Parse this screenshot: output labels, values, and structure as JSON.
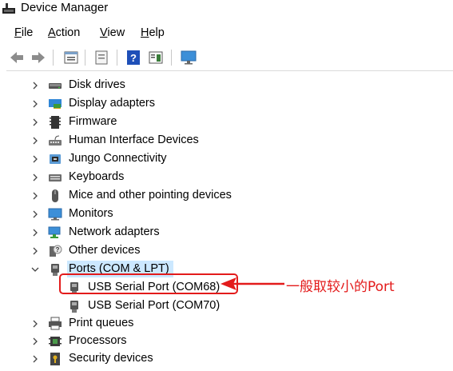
{
  "window": {
    "title": "Device Manager",
    "icon": "device-manager-icon"
  },
  "menu": [
    {
      "label": "File",
      "accel": "F",
      "rest": "ile"
    },
    {
      "label": "Action",
      "accel": "A",
      "rest": "ction"
    },
    {
      "label": "View",
      "accel": "V",
      "rest": "iew"
    },
    {
      "label": "Help",
      "accel": "H",
      "rest": "elp"
    }
  ],
  "toolbar": {
    "buttons": [
      "back-arrow-icon",
      "forward-arrow-icon",
      "properties-icon",
      "show-hide-tree-icon",
      "help-icon",
      "action-pane-icon",
      "monitor-icon"
    ]
  },
  "tree": {
    "items": [
      {
        "label": "Disk drives",
        "icon": "disk-drive-icon",
        "expanded": false
      },
      {
        "label": "Display adapters",
        "icon": "display-adapter-icon",
        "expanded": false
      },
      {
        "label": "Firmware",
        "icon": "firmware-icon",
        "expanded": false
      },
      {
        "label": "Human Interface Devices",
        "icon": "hid-icon",
        "expanded": false
      },
      {
        "label": "Jungo Connectivity",
        "icon": "usb-device-icon",
        "expanded": false
      },
      {
        "label": "Keyboards",
        "icon": "keyboard-icon",
        "expanded": false
      },
      {
        "label": "Mice and other pointing devices",
        "icon": "mouse-icon",
        "expanded": false
      },
      {
        "label": "Monitors",
        "icon": "monitor-icon",
        "expanded": false
      },
      {
        "label": "Network adapters",
        "icon": "network-adapter-icon",
        "expanded": false
      },
      {
        "label": "Other devices",
        "icon": "unknown-device-icon",
        "expanded": false
      },
      {
        "label": "Ports (COM & LPT)",
        "icon": "port-icon",
        "expanded": true,
        "selected": true,
        "children": [
          {
            "label": "USB Serial Port (COM68)",
            "icon": "port-icon",
            "highlighted": true
          },
          {
            "label": "USB Serial Port (COM70)",
            "icon": "port-icon"
          }
        ]
      },
      {
        "label": "Print queues",
        "icon": "printer-icon",
        "expanded": false
      },
      {
        "label": "Processors",
        "icon": "processor-icon",
        "expanded": false
      },
      {
        "label": "Security devices",
        "icon": "security-device-icon",
        "expanded": false
      }
    ]
  },
  "annotation": {
    "text": "一般取较小的Port",
    "color": "#e31b1b"
  }
}
